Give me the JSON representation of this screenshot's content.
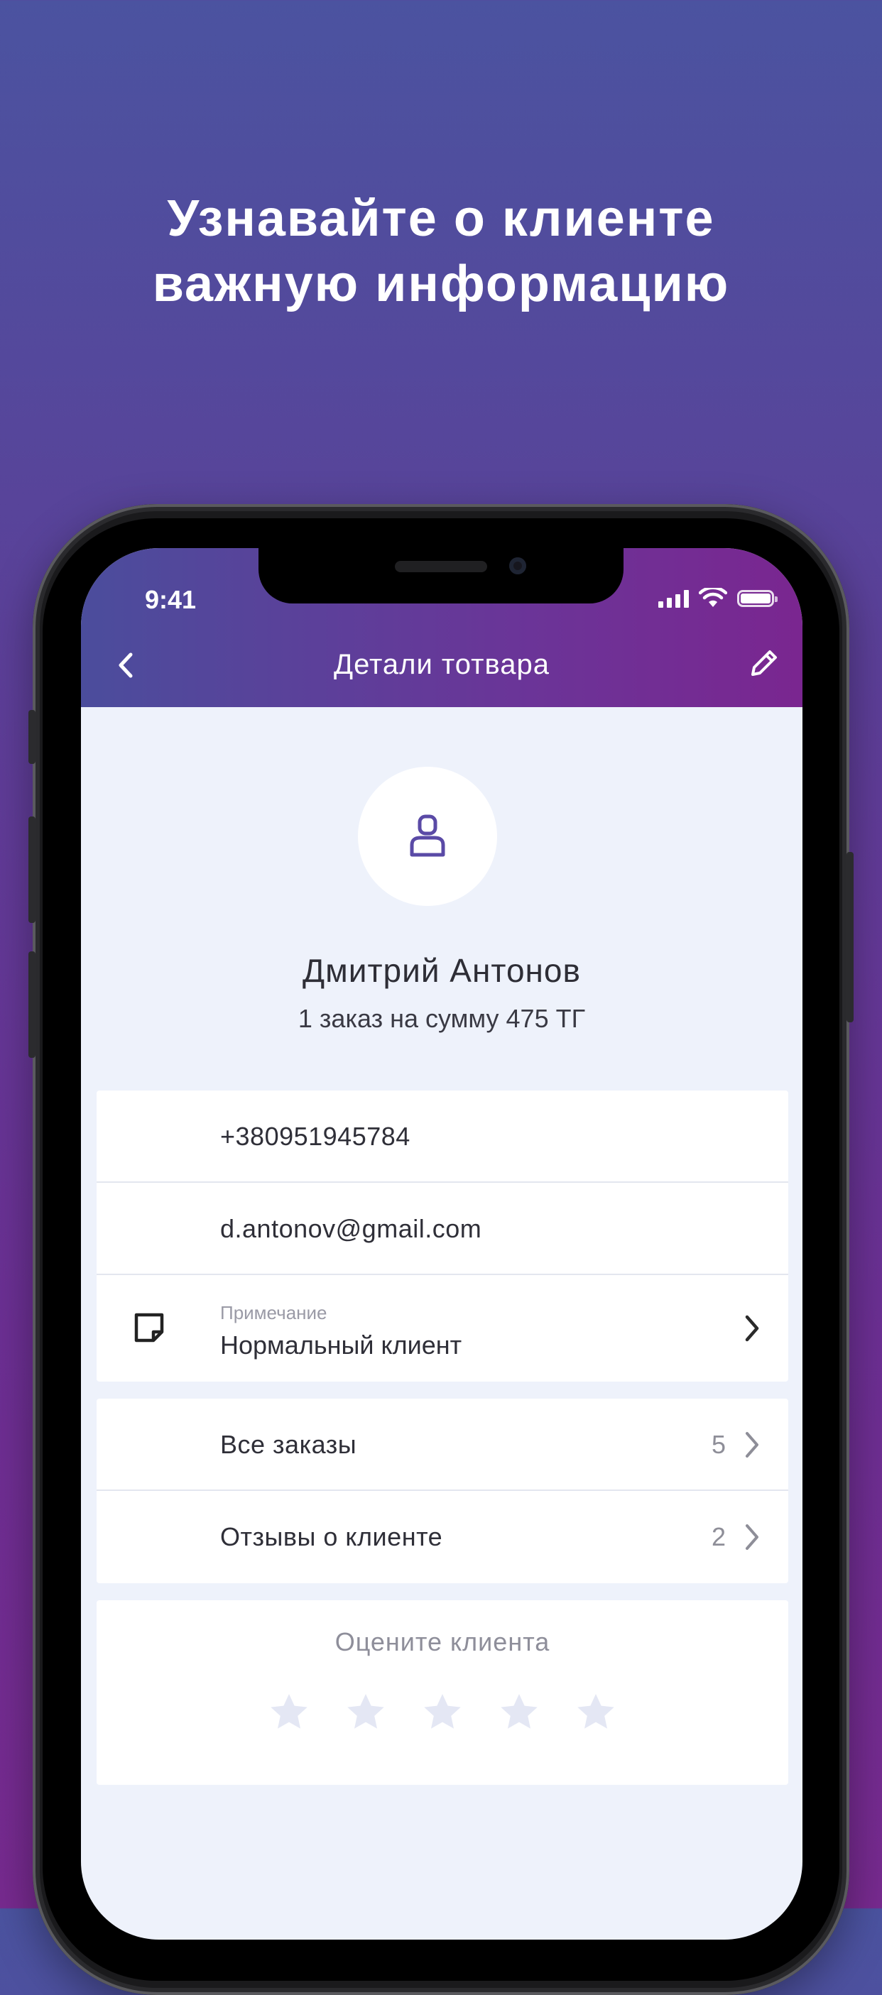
{
  "headline": {
    "line1": "Узнавайте о клиенте",
    "line2": "важную информацию"
  },
  "status_bar": {
    "time": "9:41"
  },
  "nav": {
    "title": "Детали тотвара",
    "back_icon": "chevron-left-icon",
    "edit_icon": "pencil-icon"
  },
  "profile": {
    "avatar_icon": "user-icon",
    "name": "Дмитрий Антонов",
    "summary": "1 заказ на сумму 475 ТГ"
  },
  "contacts": {
    "phone": "+380951945784",
    "email": "d.antonov@gmail.com",
    "note_label": "Примечание",
    "note_value": "Нормальный клиент"
  },
  "links": {
    "orders_label": "Все заказы",
    "orders_count": "5",
    "reviews_label": "Отзывы о клиенте",
    "reviews_count": "2"
  },
  "rating": {
    "title": "Оцените клиента",
    "value": 0,
    "max": 5
  },
  "colors": {
    "accent": "#5a4aa6",
    "star_empty": "#e4e7f4",
    "screen_bg": "#eef2fb"
  }
}
